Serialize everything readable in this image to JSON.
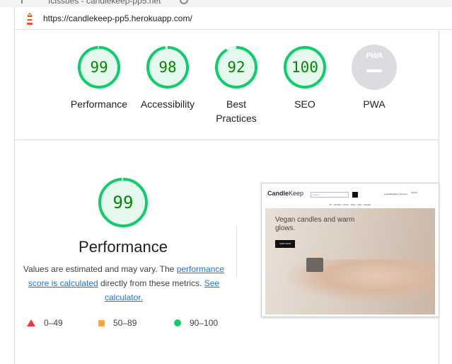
{
  "browser": {
    "tab_text": "Icissues - candlekeep-pp5.net",
    "url": "https://candlekeep-pp5.herokuapp.com/"
  },
  "categories": [
    {
      "label": "Performance",
      "score": "99",
      "fraction": 0.99
    },
    {
      "label": "Accessibility",
      "score": "98",
      "fraction": 0.98
    },
    {
      "label": "Best Practices",
      "score": "92",
      "fraction": 0.92
    },
    {
      "label": "SEO",
      "score": "100",
      "fraction": 1.0
    },
    {
      "label": "PWA",
      "score": ""
    }
  ],
  "pwa_badge": "PWA",
  "performance": {
    "score": "99",
    "fraction": 0.99,
    "title": "Performance",
    "desc_part1": "Values are estimated and may vary. The",
    "link_score_calc": "performance score is calculated",
    "desc_part2": "directly from these metrics.",
    "link_see_calc": "See calculator."
  },
  "legend": [
    {
      "label": "0–49",
      "color": "#ff3333"
    },
    {
      "label": "50–89",
      "color": "#ffaa33"
    },
    {
      "label": "90–100",
      "color": "#0cce6b"
    }
  ],
  "screenshot": {
    "brand_bold": "Candle",
    "brand_thin": "Keep",
    "search_placeholder": "Search...",
    "account": "Login/Register | Account",
    "bag": "€0.00",
    "nav_links": "All Candles   About   Shop   Add Candles",
    "headline": "Vegan candles and warm glows.",
    "shop_button": "SHOP NOW"
  },
  "colors": {
    "pass_green": "#0cce6b",
    "pass_text": "#008800",
    "pass_bg": "#e6f9ef",
    "link": "#1a73e8"
  }
}
